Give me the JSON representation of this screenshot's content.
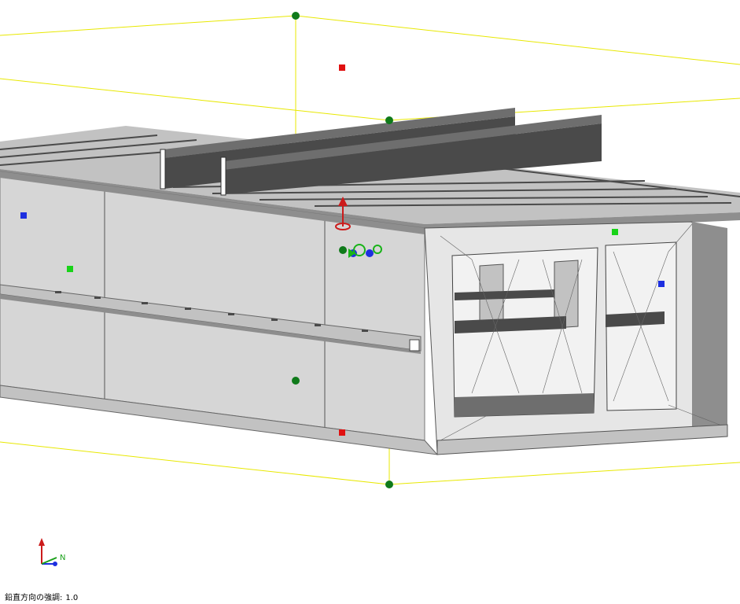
{
  "colors": {
    "background": "#ffffff",
    "bounding_box": "#e8e800",
    "steel_dark": "#4a4a4a",
    "steel_mid": "#6e6e6e",
    "concrete_light": "#d6d6d6",
    "concrete_mid": "#c2c2c2",
    "concrete_dark": "#8e8e8e",
    "handle_green": "#0f7a1a",
    "handle_red": "#e01010",
    "handle_blue": "#1d2fe0",
    "handle_lime": "#19d319",
    "axis_up": "#cc1b1b",
    "axis_north": "#1aa01a",
    "axis_east": "#1d2fe0"
  },
  "icons": {
    "gizmo": "move-rotate-gizmo-icon",
    "axis": "axis-triad-icon"
  },
  "axis_indicator": {
    "north_label": "N"
  },
  "status_bar": {
    "label": "鉛直方向の強調:",
    "value": "1.0"
  }
}
